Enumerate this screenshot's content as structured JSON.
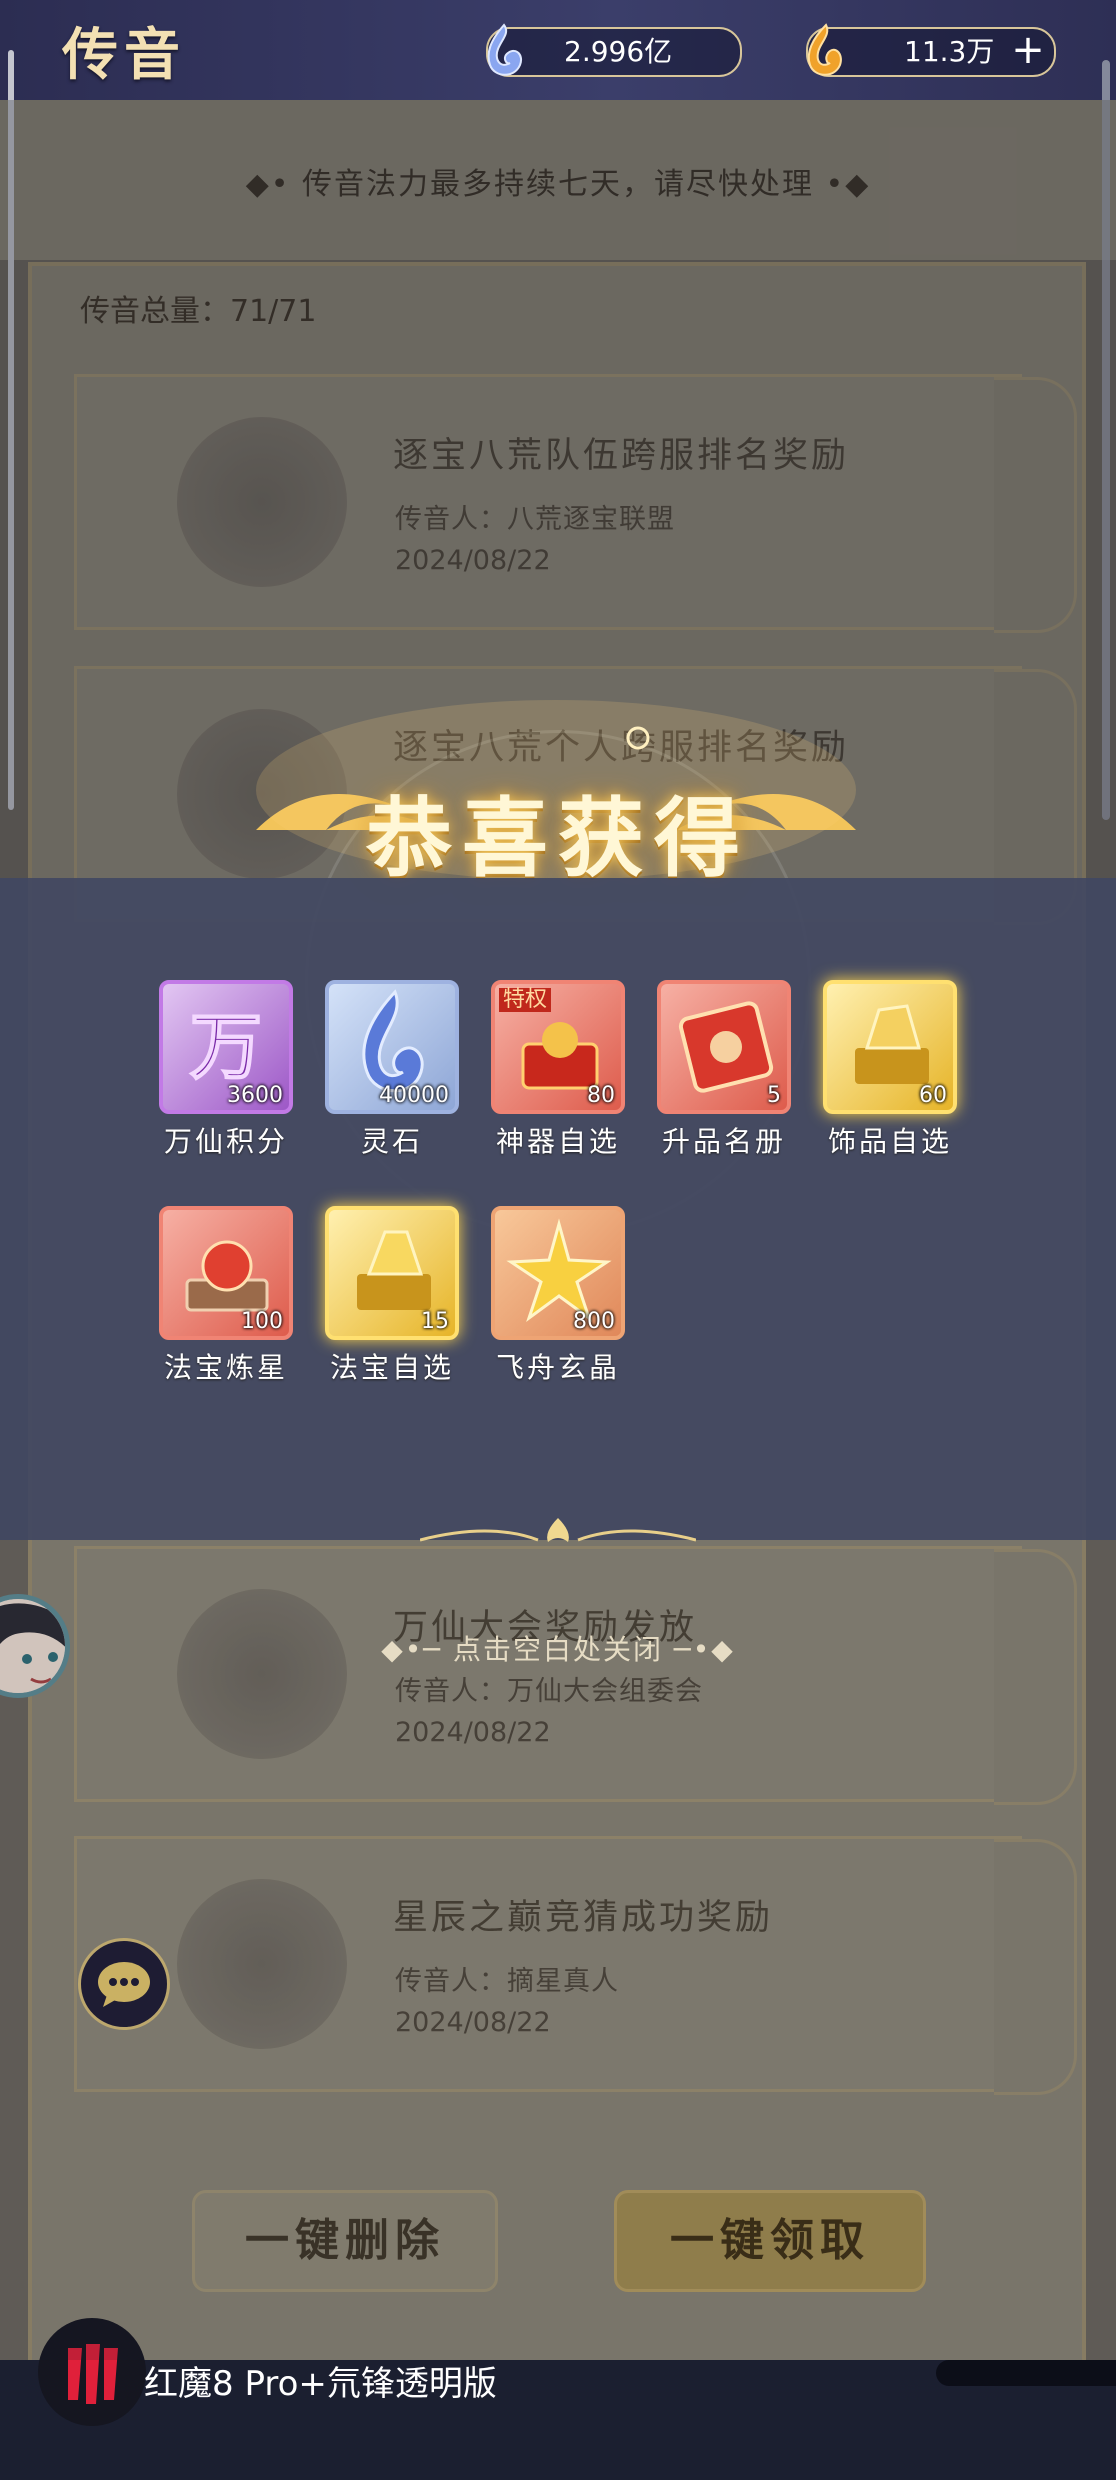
{
  "header": {
    "title": "传音",
    "spirit_stones": "2.996亿",
    "gold": "11.3万"
  },
  "notice": "◆• 传音法力最多持续七天，请尽快处理 •◆",
  "mailbox": {
    "total_label": "传音总量：71/71",
    "mails": [
      {
        "title": "逐宝八荒队伍跨服排名奖励",
        "sender": "传音人：八荒逐宝联盟",
        "date": "2024/08/22"
      },
      {
        "title": "逐宝八荒个人跨服排名奖励",
        "sender": "",
        "date": ""
      },
      {
        "title": "万仙大会奖励发放",
        "sender": "传音人：万仙大会组委会",
        "date": "2024/08/22"
      },
      {
        "title": "星辰之巅竞猜成功奖励",
        "sender": "传音人：摘星真人",
        "date": "2024/08/22"
      }
    ],
    "delete_all": "一键删除",
    "claim_all": "一键领取"
  },
  "popup": {
    "title": "恭喜获得",
    "close_hint": "◆•─ 点击空白处关闭 ─•◆",
    "rewards": [
      {
        "name": "万仙积分",
        "count": "3600",
        "rarity": "purple",
        "icon": "wanxian-points-icon"
      },
      {
        "name": "灵石",
        "count": "40000",
        "rarity": "blue",
        "icon": "spirit-stone-icon"
      },
      {
        "name": "神器自选",
        "count": "80",
        "rarity": "red",
        "icon": "artifact-chest-icon",
        "badge": "特权"
      },
      {
        "name": "升品名册",
        "count": "5",
        "rarity": "red",
        "icon": "scroll-icon"
      },
      {
        "name": "饰品自选",
        "count": "60",
        "rarity": "gold",
        "icon": "accessory-chest-icon"
      },
      {
        "name": "法宝炼星",
        "count": "100",
        "rarity": "red",
        "icon": "treasure-star-icon"
      },
      {
        "name": "法宝自选",
        "count": "15",
        "rarity": "gold",
        "icon": "treasure-chest-icon"
      },
      {
        "name": "飞舟玄晶",
        "count": "800",
        "rarity": "orange",
        "icon": "crystal-shard-icon"
      }
    ]
  },
  "watermark": "红魔8 Pro+氘锋透明版",
  "colors": {
    "header_bg": "#2c2d52",
    "popup_bg": "#404660",
    "gold_text": "#f3e0b3",
    "title_glow": "#f3c65c"
  }
}
